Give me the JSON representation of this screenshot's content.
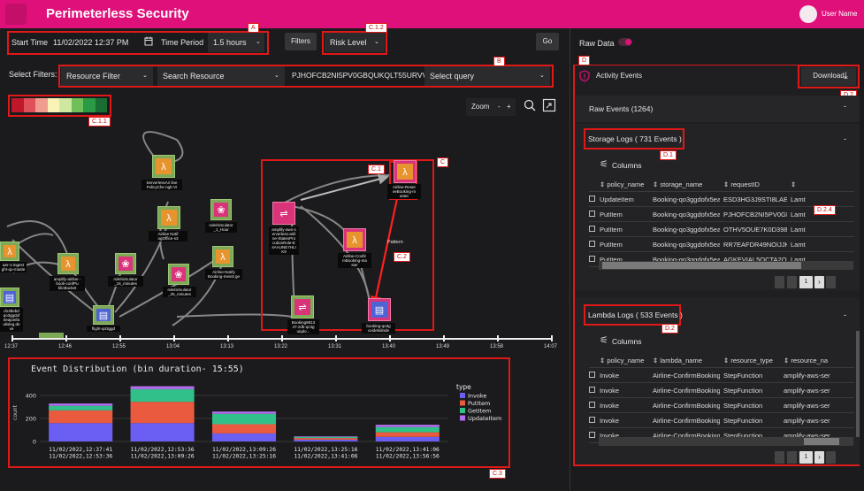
{
  "header": {
    "title": "Perimeterless Security",
    "user_name": "User Name"
  },
  "controls": {
    "start_time_label": "Start Time",
    "start_time_value": "11/02/2022 12:37 PM",
    "time_period_label": "Time Period",
    "time_period_value": "1.5 hours",
    "filters_button": "Filters",
    "risk_level_label": "Risk Level",
    "go_button": "Go",
    "select_filters_label": "Select Filters:",
    "resource_filter": "Resource Filter",
    "search_resource": "Search Resource",
    "filter_value": "PJHOFCB2NI5PV0GBQUKQLT55URVV4",
    "select_query": "Select query",
    "zoom_label": "Zoom",
    "zoom_minus": "-",
    "zoom_plus": "+"
  },
  "risk_colors": [
    "#c0172b",
    "#e0505a",
    "#ef9d8f",
    "#fbf3b5",
    "#cfe8a0",
    "#6fbf5a",
    "#2a9a44",
    "#1a6e33"
  ],
  "annotations": {
    "A": "A",
    "C12": "C.1.2",
    "B": "B",
    "C11": "C.1.1",
    "C": "C",
    "C1": "C.1",
    "C2": "C.2",
    "C3": "C.3",
    "D": "D",
    "D2": "D.2",
    "D1": "D.1",
    "D24": "D.2.4",
    "D2b": "D.2"
  },
  "graph": {
    "pattern_label": "Pattern",
    "nodes": [
      {
        "id": "n1",
        "label": "ServerlessAir line PolicyChe ngb-VI",
        "color": "#7ea957",
        "icon": "lambda-icon"
      },
      {
        "id": "n2",
        "label": "Airline Notif ogOffice-s3",
        "color": "#7ea957",
        "icon": "lambda-icon"
      },
      {
        "id": "n3",
        "label": "rule/simulator _1_Hour",
        "color": "#7ea957",
        "icon": "event-rule-icon"
      },
      {
        "id": "n4",
        "label": "amplify-airline -book-confPu blicBucket",
        "color": "#7ea957",
        "icon": "lambda-icon"
      },
      {
        "id": "n5",
        "label": "rule/simulator _15_minutes",
        "color": "#7ea957",
        "icon": "event-rule-icon"
      },
      {
        "id": "n6",
        "label": "rule/simulator _25_minutes",
        "color": "#7ea957",
        "icon": "event-rule-icon"
      },
      {
        "id": "n7",
        "label": "Airline-Notify Booking-messt ge",
        "color": "#7ea957",
        "icon": "lambda-icon"
      },
      {
        "id": "n8",
        "label": "flight-qn3ggd",
        "color": "#7ea957",
        "icon": "table-icon"
      },
      {
        "id": "n9",
        "label": "amplify-aws-s erverless-airli ne-StatesPro cutionRole-E 4AAUNE7HLI K9",
        "color": "#d9337a",
        "icon": "step-function-icon"
      },
      {
        "id": "n10",
        "label": "Airline-Reser veBooking-m aster",
        "color": "#d9337a",
        "icon": "lambda-icon"
      },
      {
        "id": "n11",
        "label": "Airline-Confir mBooking-ma ster",
        "color": "#d9337a",
        "icon": "lambda-icon"
      },
      {
        "id": "n12",
        "label": "Booking9813 47-zdb-qc3g uiqdo...",
        "color": "#7ea957",
        "icon": "step-function-icon"
      },
      {
        "id": "n13",
        "label": "booking-qo3g ovidekdinde",
        "color": "#d9337a",
        "icon": "table-icon"
      },
      {
        "id": "n14",
        "label": "aer-1-ingest ght-qo-maste",
        "color": "#7ea957",
        "icon": "lambda-icon"
      },
      {
        "id": "n15",
        "label": "d13bebd qo3ggdof 5eajoeifa ulisleg.de ve",
        "color": "#7ea957",
        "icon": "table-icon"
      }
    ]
  },
  "timeline": {
    "ticks": [
      "12:37",
      "12:46",
      "12:55",
      "13:04",
      "13:13",
      "13:22",
      "13:31",
      "13:40",
      "13:49",
      "13:58",
      "14:07"
    ]
  },
  "chart_data": {
    "type": "bar",
    "title": "Event Distribution (bin duration- 15:55)",
    "xlabel": "",
    "ylabel": "count",
    "ylim": [
      0,
      500
    ],
    "yticks": [
      0,
      200,
      400
    ],
    "legend_title": "type",
    "categories": [
      "11/02/2022,12:37:41 11/02/2022,12:53:36",
      "11/02/2022,12:53:36 11/02/2022,13:09:26",
      "11/02/2022,13:09:26 11/02/2022,13:25:16",
      "11/02/2022,13:25:16 11/02/2022,13:41:06",
      "11/02/2022,13:41:06 11/02/2022,13:56:56"
    ],
    "category_lines": [
      [
        "11/02/2022,12:37:41",
        "11/02/2022,12:53:36"
      ],
      [
        "11/02/2022,12:53:36",
        "11/02/2022,13:09:26"
      ],
      [
        "11/02/2022,13:09:26",
        "11/02/2022,13:25:16"
      ],
      [
        "11/02/2022,13:25:16",
        "11/02/2022,13:41:06"
      ],
      [
        "11/02/2022,13:41:06",
        "11/02/2022,13:56:56"
      ]
    ],
    "series": [
      {
        "name": "Invoke",
        "color": "#6a5ff2",
        "values": [
          160,
          160,
          70,
          15,
          40
        ]
      },
      {
        "name": "PutItem",
        "color": "#ea5a3f",
        "values": [
          110,
          185,
          80,
          15,
          40
        ]
      },
      {
        "name": "GetItem",
        "color": "#31c08a",
        "values": [
          40,
          110,
          90,
          10,
          45
        ]
      },
      {
        "name": "UpdateItem",
        "color": "#b46ff0",
        "values": [
          20,
          25,
          20,
          5,
          20
        ]
      }
    ]
  },
  "right": {
    "raw_data_label": "Raw Data",
    "activity_events": "Activity Events",
    "download_button": "Download",
    "raw_events": "Raw Events (1264)",
    "storage_title": "Storage Logs ( 731 Events )",
    "columns_label": "Columns",
    "storage_headers": [
      "policy_name",
      "storage_name",
      "requestID",
      ""
    ],
    "storage_rows": [
      [
        "UpdateItem",
        "Booking-qo3ggdofx5eajo...",
        "ESD3HG3J9STI8LAED2...",
        "Lamt"
      ],
      [
        "PutItem",
        "Booking-qo3ggdofx5eajo...",
        "PJHOFCB2NI5PV0GBQ...",
        "Lamt"
      ],
      [
        "PutItem",
        "Booking-qo3ggdofx5eajo...",
        "OTHV5OUE7K0D398RF...",
        "Lamt"
      ],
      [
        "PutItem",
        "Booking-qo3ggdofx5eajo...",
        "RR7EAFDR49NOIJJKID...",
        "Lamt"
      ],
      [
        "PutItem",
        "Booking-qo3ggdofx5eajo...",
        "AGKEVIAL5QCTA2QAOI...",
        "Lamt"
      ]
    ],
    "lambda_title": "Lambda Logs ( 533 Events )",
    "lambda_headers": [
      "policy_name",
      "lambda_name",
      "resource_type",
      "resource_na"
    ],
    "lambda_rows": [
      [
        "Invoke",
        "Airline-ConfirmBooking-m...",
        "StepFunction",
        "amplify-aws-ser"
      ],
      [
        "Invoke",
        "Airline-ConfirmBooking-m...",
        "StepFunction",
        "amplify-aws-ser"
      ],
      [
        "Invoke",
        "Airline-ConfirmBooking-m...",
        "StepFunction",
        "amplify-aws-ser"
      ],
      [
        "Invoke",
        "Airline-ConfirmBooking-m...",
        "StepFunction",
        "amplify-aws-ser"
      ],
      [
        "Invoke",
        "Airline-ConfirmBooking-m...",
        "StepFunction",
        "amplify-aws-ser"
      ]
    ],
    "page_number": "1",
    "collapse_symbol": "-"
  }
}
